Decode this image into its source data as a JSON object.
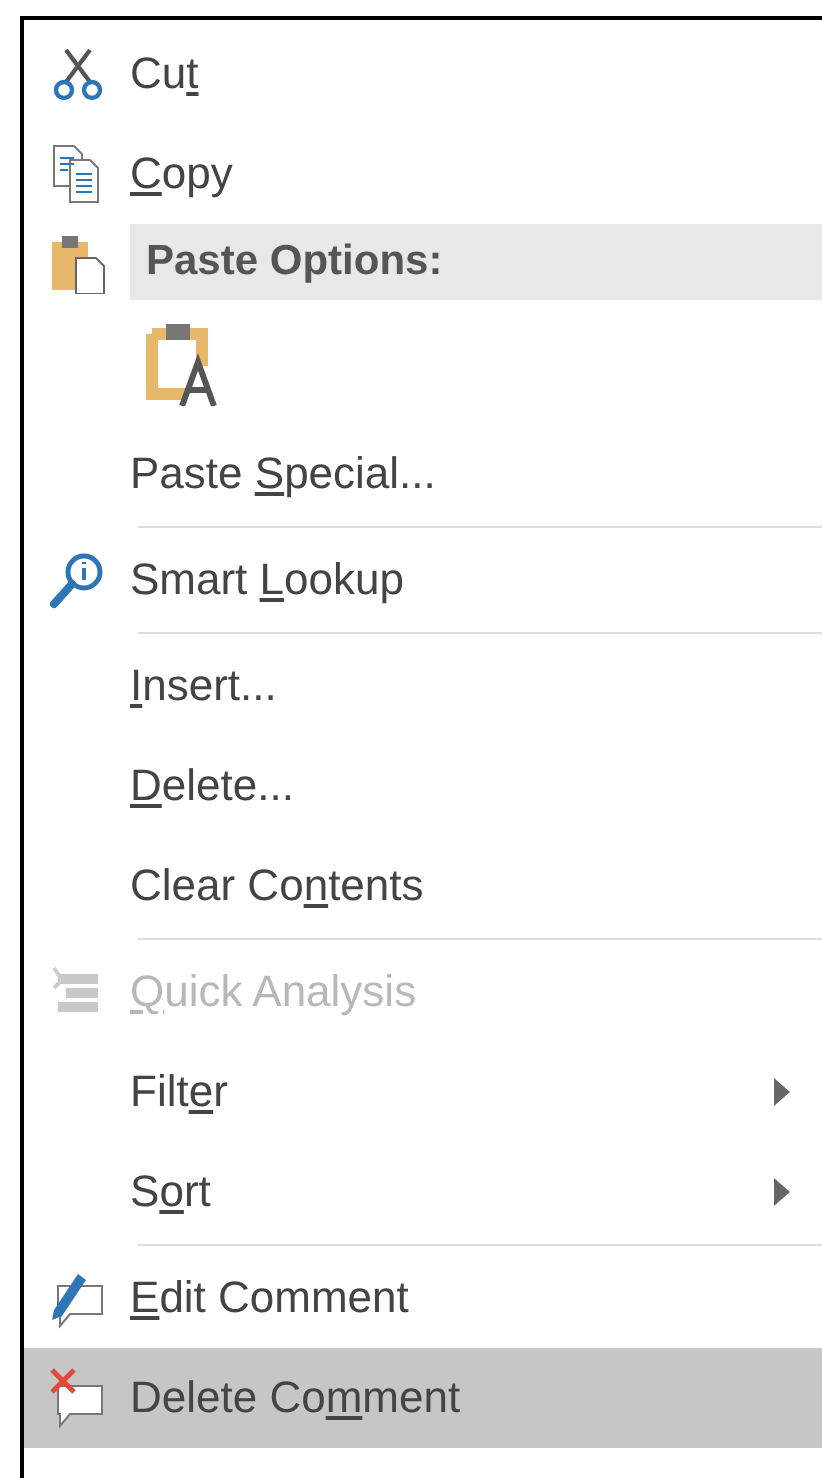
{
  "menu": {
    "items": [
      {
        "kind": "item",
        "text_before": "Cu",
        "access_key": "t",
        "disabled": false,
        "selected": false,
        "submenu": false
      },
      {
        "kind": "item",
        "access_key": "C",
        "text_after": "opy",
        "disabled": false,
        "selected": false,
        "submenu": false
      },
      {
        "kind": "header",
        "text": "Paste Options:"
      },
      {
        "kind": "paste_options"
      },
      {
        "kind": "item",
        "text_before": "Paste ",
        "access_key": "S",
        "text_after": "pecial...",
        "disabled": false,
        "selected": false,
        "submenu": false
      },
      {
        "kind": "separator"
      },
      {
        "kind": "item",
        "text_before": "Smart ",
        "access_key": "L",
        "text_after": "ookup",
        "disabled": false,
        "selected": false,
        "submenu": false
      },
      {
        "kind": "separator"
      },
      {
        "kind": "item",
        "access_key": "I",
        "text_after": "nsert...",
        "disabled": false,
        "selected": false,
        "submenu": false
      },
      {
        "kind": "item",
        "access_key": "D",
        "text_after": "elete...",
        "disabled": false,
        "selected": false,
        "submenu": false
      },
      {
        "kind": "item",
        "text_before": "Clear Co",
        "access_key": "n",
        "text_after": "tents",
        "disabled": false,
        "selected": false,
        "submenu": false
      },
      {
        "kind": "separator"
      },
      {
        "kind": "item",
        "access_key": "Q",
        "text_after": "uick Analysis",
        "disabled": true,
        "selected": false,
        "submenu": false
      },
      {
        "kind": "item",
        "text_before": "Filt",
        "access_key": "e",
        "text_after": "r",
        "disabled": false,
        "selected": false,
        "submenu": true
      },
      {
        "kind": "item",
        "text_before": "S",
        "access_key": "o",
        "text_after": "rt",
        "disabled": false,
        "selected": false,
        "submenu": true
      },
      {
        "kind": "separator"
      },
      {
        "kind": "item",
        "access_key": "E",
        "text_after": "dit Comment",
        "disabled": false,
        "selected": false,
        "submenu": false
      },
      {
        "kind": "item",
        "text_before": "Delete Co",
        "access_key": "m",
        "text_after": "ment",
        "disabled": false,
        "selected": true,
        "submenu": false
      }
    ]
  }
}
